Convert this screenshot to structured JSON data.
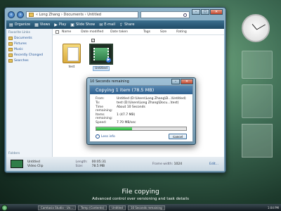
{
  "explorer": {
    "address": "« Long Zhang › Documents › Untitled",
    "toolbar": {
      "organize": "Organize",
      "views": "Views",
      "play": "Play",
      "slideshow": "Slide Show",
      "email": "E-mail",
      "share": "Share"
    },
    "sidebar": {
      "heading": "Favorite Links",
      "items": [
        "Documents",
        "Pictures",
        "Music",
        "Recently Changed",
        "Searches"
      ],
      "folders": "Folders"
    },
    "columns": [
      "Name",
      "Date modified",
      "Date taken",
      "Tags",
      "Size",
      "Rating"
    ],
    "files": [
      {
        "label": "test",
        "type": "folder"
      },
      {
        "label": "Untitled",
        "type": "video"
      }
    ],
    "details": {
      "name": "Untitled",
      "type": "Video Clip",
      "length_key": "Length:",
      "length_val": "00:05:31",
      "size_key": "Size:",
      "size_val": "78.5 MB",
      "frame_key": "Frame width:",
      "frame_val": "1024",
      "edit": "Edit..."
    }
  },
  "dialog": {
    "title": "10 Seconds remaining",
    "header": "Copying 1 item (78.5 MB)",
    "rows": [
      {
        "k": "From:",
        "v": "Untitled (D:\\Users\\Long Zhang\\D...\\Untitled)"
      },
      {
        "k": "To:",
        "v": "test (D:\\Users\\Long Zhang\\Docu...\\test)"
      },
      {
        "k": "Time remaining:",
        "v": "About 10 Seconds"
      },
      {
        "k": "Items remaining:",
        "v": "1 (47.7 MB)"
      },
      {
        "k": "Speed:",
        "v": "7.70 MB/sec"
      }
    ],
    "progress_fraction": 0.4,
    "less_info": "Less info",
    "cancel": "Cancel"
  },
  "caption": {
    "title": "File copying",
    "subtitle": "Advanced control over versioning and task details"
  },
  "taskbar": {
    "tasks": [
      "Camtasia Studio - Un...",
      "Temp (Contents)",
      "Untitled",
      "10 Seconds remaining"
    ],
    "clock": "1:04 PM"
  }
}
